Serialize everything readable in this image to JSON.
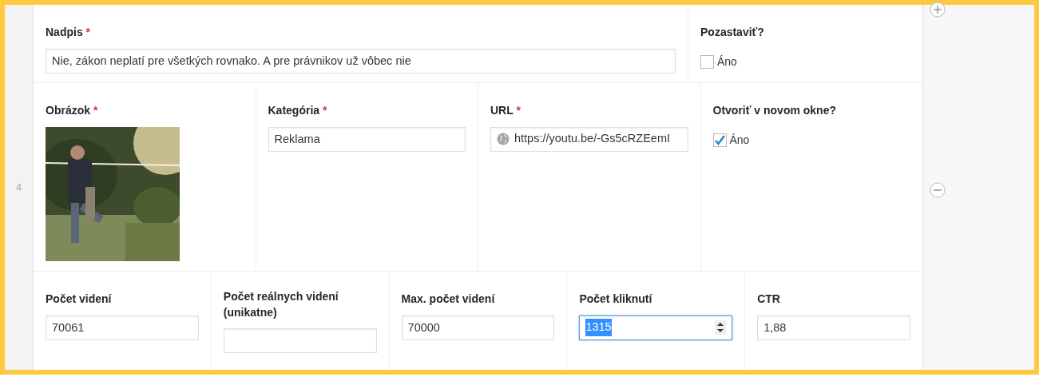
{
  "row_number": "4",
  "rows": [
    {
      "fields": [
        {
          "kind": "text",
          "label": "Nadpis",
          "required_mark": "*",
          "value": "Nie, zákon neplatí pre všetkých rovnako. A pre právnikov už vôbec nie"
        },
        {
          "kind": "checkbox",
          "label": "Pozastaviť?",
          "option": "Áno",
          "checked": false
        }
      ]
    },
    {
      "fields": [
        {
          "label": "Obrázok",
          "required_mark": "*"
        },
        {
          "kind": "text",
          "label": "Kategória",
          "required_mark": "*",
          "value": "Reklama"
        },
        {
          "kind": "url",
          "label": "URL",
          "required_mark": "*",
          "value": "https://youtu.be/-Gs5cRZEemI"
        },
        {
          "kind": "checkbox",
          "label": "Otvoriť v novom okne?",
          "option": "Áno",
          "checked": true
        }
      ]
    },
    {
      "fields": [
        {
          "kind": "text",
          "label": "Počet videní",
          "value": "70061"
        },
        {
          "kind": "text",
          "label": "Počet reálnych videní (unikatne)"
        },
        {
          "kind": "text",
          "label": "Max. počet videní",
          "value": "70000"
        },
        {
          "kind": "number",
          "label": "Počet kliknutí",
          "value": "1315",
          "focused": true
        },
        {
          "kind": "text",
          "label": "CTR",
          "value": "1,88"
        }
      ]
    }
  ]
}
